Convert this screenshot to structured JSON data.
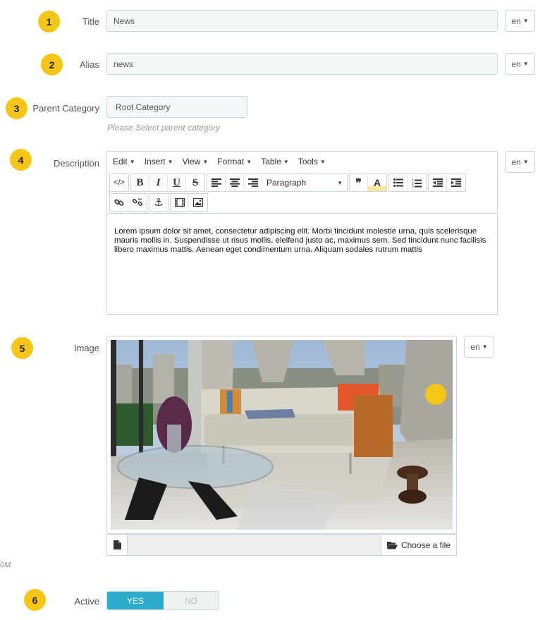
{
  "form": {
    "title": {
      "step": "1",
      "label": "Title",
      "value": "News",
      "lang": "en"
    },
    "alias": {
      "step": "2",
      "label": "Alias",
      "value": "news",
      "lang": "en"
    },
    "parent": {
      "step": "3",
      "label": "Parent Category",
      "value": "Root Category",
      "hint": "Please Select parent category"
    },
    "description": {
      "step": "4",
      "label": "Description",
      "lang": "en",
      "menu": [
        "Edit",
        "Insert",
        "View",
        "Format",
        "Table",
        "Tools"
      ],
      "block_format": "Paragraph",
      "content": "Lorem ipsum dolor sit amet, consectetur adipiscing elit. Morbi tincidunt molestie urna, quis scelerisque mauris mollis in. Suspendisse ut risus mollis, eleifend justo ac, maximus sem. Sed tincidunt nunc facilisis libero maximus mattis. Aenean eget condimentum urna. Aliquam sodales rutrum mattis"
    },
    "image": {
      "step": "5",
      "label": "Image",
      "lang": "en",
      "choose_label": "Choose a file"
    },
    "active": {
      "step": "6",
      "label": "Active",
      "yes": "YES",
      "no": "NO",
      "value": "YES"
    },
    "stray_text": "0M"
  },
  "colors": {
    "badge": "#f5c518",
    "toggle_on": "#2eacce",
    "field_bg": "#f5f8f9",
    "border": "#c7d6db"
  }
}
